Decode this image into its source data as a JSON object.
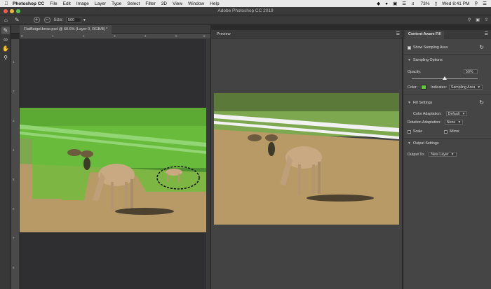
{
  "menubar": {
    "apple": "",
    "app_name": "Photoshop CC",
    "items": [
      "File",
      "Edit",
      "Image",
      "Layer",
      "Type",
      "Select",
      "Filter",
      "3D",
      "View",
      "Window",
      "Help"
    ],
    "battery": "73%",
    "clock": "Wed 8:41 PM"
  },
  "window": {
    "title": "Adobe Photoshop CC 2019"
  },
  "options": {
    "size_label": "Size:",
    "size_value": "500"
  },
  "document": {
    "tab_title": "FlatBeigeHorse.psd @ 60.6% (Layer 0, RGB/8) *"
  },
  "rulers": {
    "h": [
      "0",
      "1",
      "2",
      "3",
      "4",
      "5",
      "6"
    ],
    "v": [
      "1",
      "2",
      "3",
      "4",
      "5",
      "6",
      "7",
      "8",
      "9"
    ]
  },
  "preview": {
    "tab": "Preview"
  },
  "panel": {
    "tab": "Content-Aware Fill",
    "show_sampling_area": "Show Sampling Area",
    "sampling_options": "Sampling Options",
    "opacity_label": "Opacity:",
    "opacity_value": "50%",
    "color_label": "Color:",
    "indicates_label": "Indicates:",
    "indicates_value": "Sampling Area",
    "fill_settings": "Fill Settings",
    "color_adaptation_label": "Color Adaptation:",
    "color_adaptation_value": "Default",
    "rotation_adaptation_label": "Rotation Adaptation:",
    "rotation_adaptation_value": "None",
    "scale_label": "Scale",
    "mirror_label": "Mirror",
    "output_settings": "Output Settings",
    "output_to_label": "Output To:",
    "output_to_value": "New Layer",
    "opacity_fraction": 0.5
  },
  "colors": {
    "sampling_overlay": "#5dc530",
    "swatch": "#63c93a",
    "sky": "#2f2f32"
  },
  "icons": {
    "tools": [
      "brush-icon",
      "lasso-icon",
      "hand-icon",
      "zoom-icon"
    ]
  }
}
